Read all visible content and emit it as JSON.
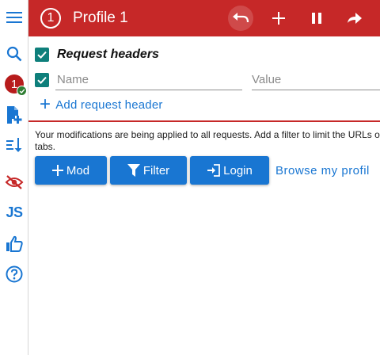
{
  "sidebar": {
    "items": [
      {
        "icon": "menu-icon"
      },
      {
        "icon": "search-icon"
      },
      {
        "icon": "profile-badge-icon",
        "badge_text": "1"
      },
      {
        "icon": "add-file-icon"
      },
      {
        "icon": "sort-icon"
      },
      {
        "icon": "eye-off-icon"
      },
      {
        "icon": "js-icon",
        "label": "JS"
      },
      {
        "icon": "thumbs-up-icon"
      },
      {
        "icon": "help-icon"
      }
    ]
  },
  "header": {
    "profile_number": "1",
    "title": "Profile 1",
    "buttons": [
      "undo-icon",
      "plus-icon",
      "pause-icon",
      "share-icon"
    ]
  },
  "request_headers": {
    "title": "Request headers",
    "name_placeholder": "Name",
    "value_placeholder": "Value",
    "add_label": "Add request header"
  },
  "notice": "Your modifications are being applied to all requests. Add a filter to limit the URLs or tabs.",
  "actions": {
    "mod_label": "Mod",
    "filter_label": "Filter",
    "login_label": "Login",
    "browse_label": "Browse my profil"
  },
  "colors": {
    "header_bg": "#c62828",
    "accent": "#1976d2",
    "checkbox": "#0e7f7b",
    "badge_check": "#2e7d32"
  }
}
